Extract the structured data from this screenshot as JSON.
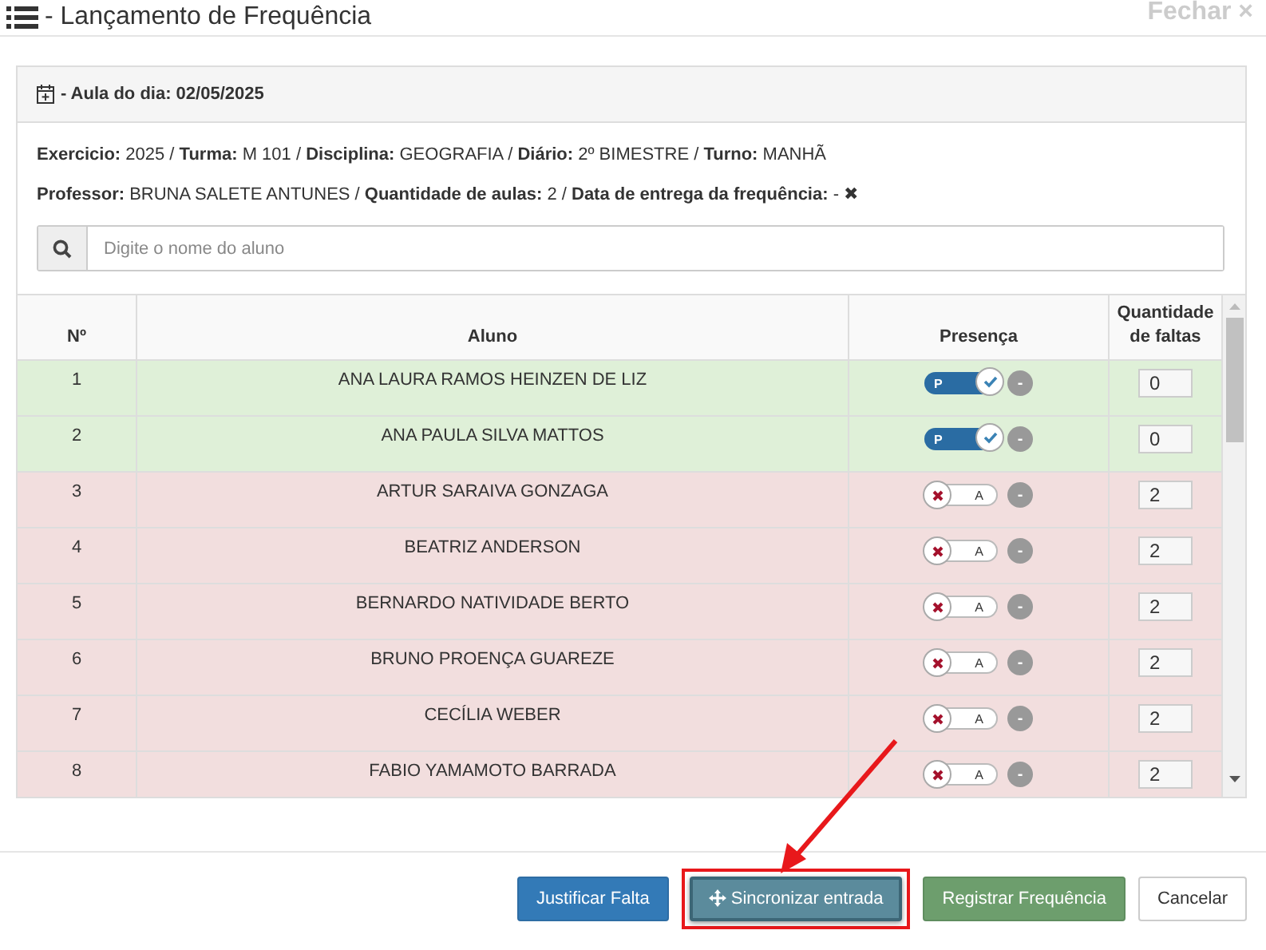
{
  "window": {
    "title": "- Lançamento de Frequência",
    "close_label": "Fechar ×"
  },
  "panel": {
    "heading": "- Aula do dia: 02/05/2025",
    "info_lines": [
      "**Exercicio:** 2025 / **Turma:** M 101 / **Disciplina:** GEOGRAFIA / **Diário:** 2º BIMESTRE / **Turno:** MANHÃ",
      "**Professor:** BRUNA SALETE ANTUNES / **Quantidade de aulas:** 2 / **Data de entrega da frequência:** - ✖"
    ]
  },
  "search": {
    "placeholder": "Digite o nome do aluno"
  },
  "table": {
    "columns": [
      "Nº",
      "Aluno",
      "Presença",
      "Quantidade de faltas"
    ],
    "rows": [
      {
        "number": "1",
        "name": "ANA LAURA RAMOS HEINZEN DE LIZ",
        "present": true,
        "toggle_label": "P",
        "clear_label": "-",
        "absences": "0"
      },
      {
        "number": "2",
        "name": "ANA PAULA SILVA MATTOS",
        "present": true,
        "toggle_label": "P",
        "clear_label": "-",
        "absences": "0"
      },
      {
        "number": "3",
        "name": "ARTUR SARAIVA GONZAGA",
        "present": false,
        "toggle_label": "A",
        "clear_label": "-",
        "absences": "2"
      },
      {
        "number": "4",
        "name": "BEATRIZ ANDERSON",
        "present": false,
        "toggle_label": "A",
        "clear_label": "-",
        "absences": "2"
      },
      {
        "number": "5",
        "name": "BERNARDO NATIVIDADE BERTO",
        "present": false,
        "toggle_label": "A",
        "clear_label": "-",
        "absences": "2"
      },
      {
        "number": "6",
        "name": "BRUNO PROENÇA GUAREZE",
        "present": false,
        "toggle_label": "A",
        "clear_label": "-",
        "absences": "2"
      },
      {
        "number": "7",
        "name": "CECÍLIA WEBER",
        "present": false,
        "toggle_label": "A",
        "clear_label": "-",
        "absences": "2"
      },
      {
        "number": "8",
        "name": "FABIO YAMAMOTO BARRADA",
        "present": false,
        "toggle_label": "A",
        "clear_label": "-",
        "absences": "2"
      }
    ]
  },
  "buttons": [
    {
      "label": "Justificar Falta",
      "kind": "primary",
      "highlighted": false
    },
    {
      "label": "Sincronizar entrada",
      "kind": "info",
      "highlighted": true
    },
    {
      "label": "Registrar Frequência",
      "kind": "success",
      "highlighted": false
    },
    {
      "label": "Cancelar",
      "kind": "default",
      "highlighted": false
    }
  ]
}
